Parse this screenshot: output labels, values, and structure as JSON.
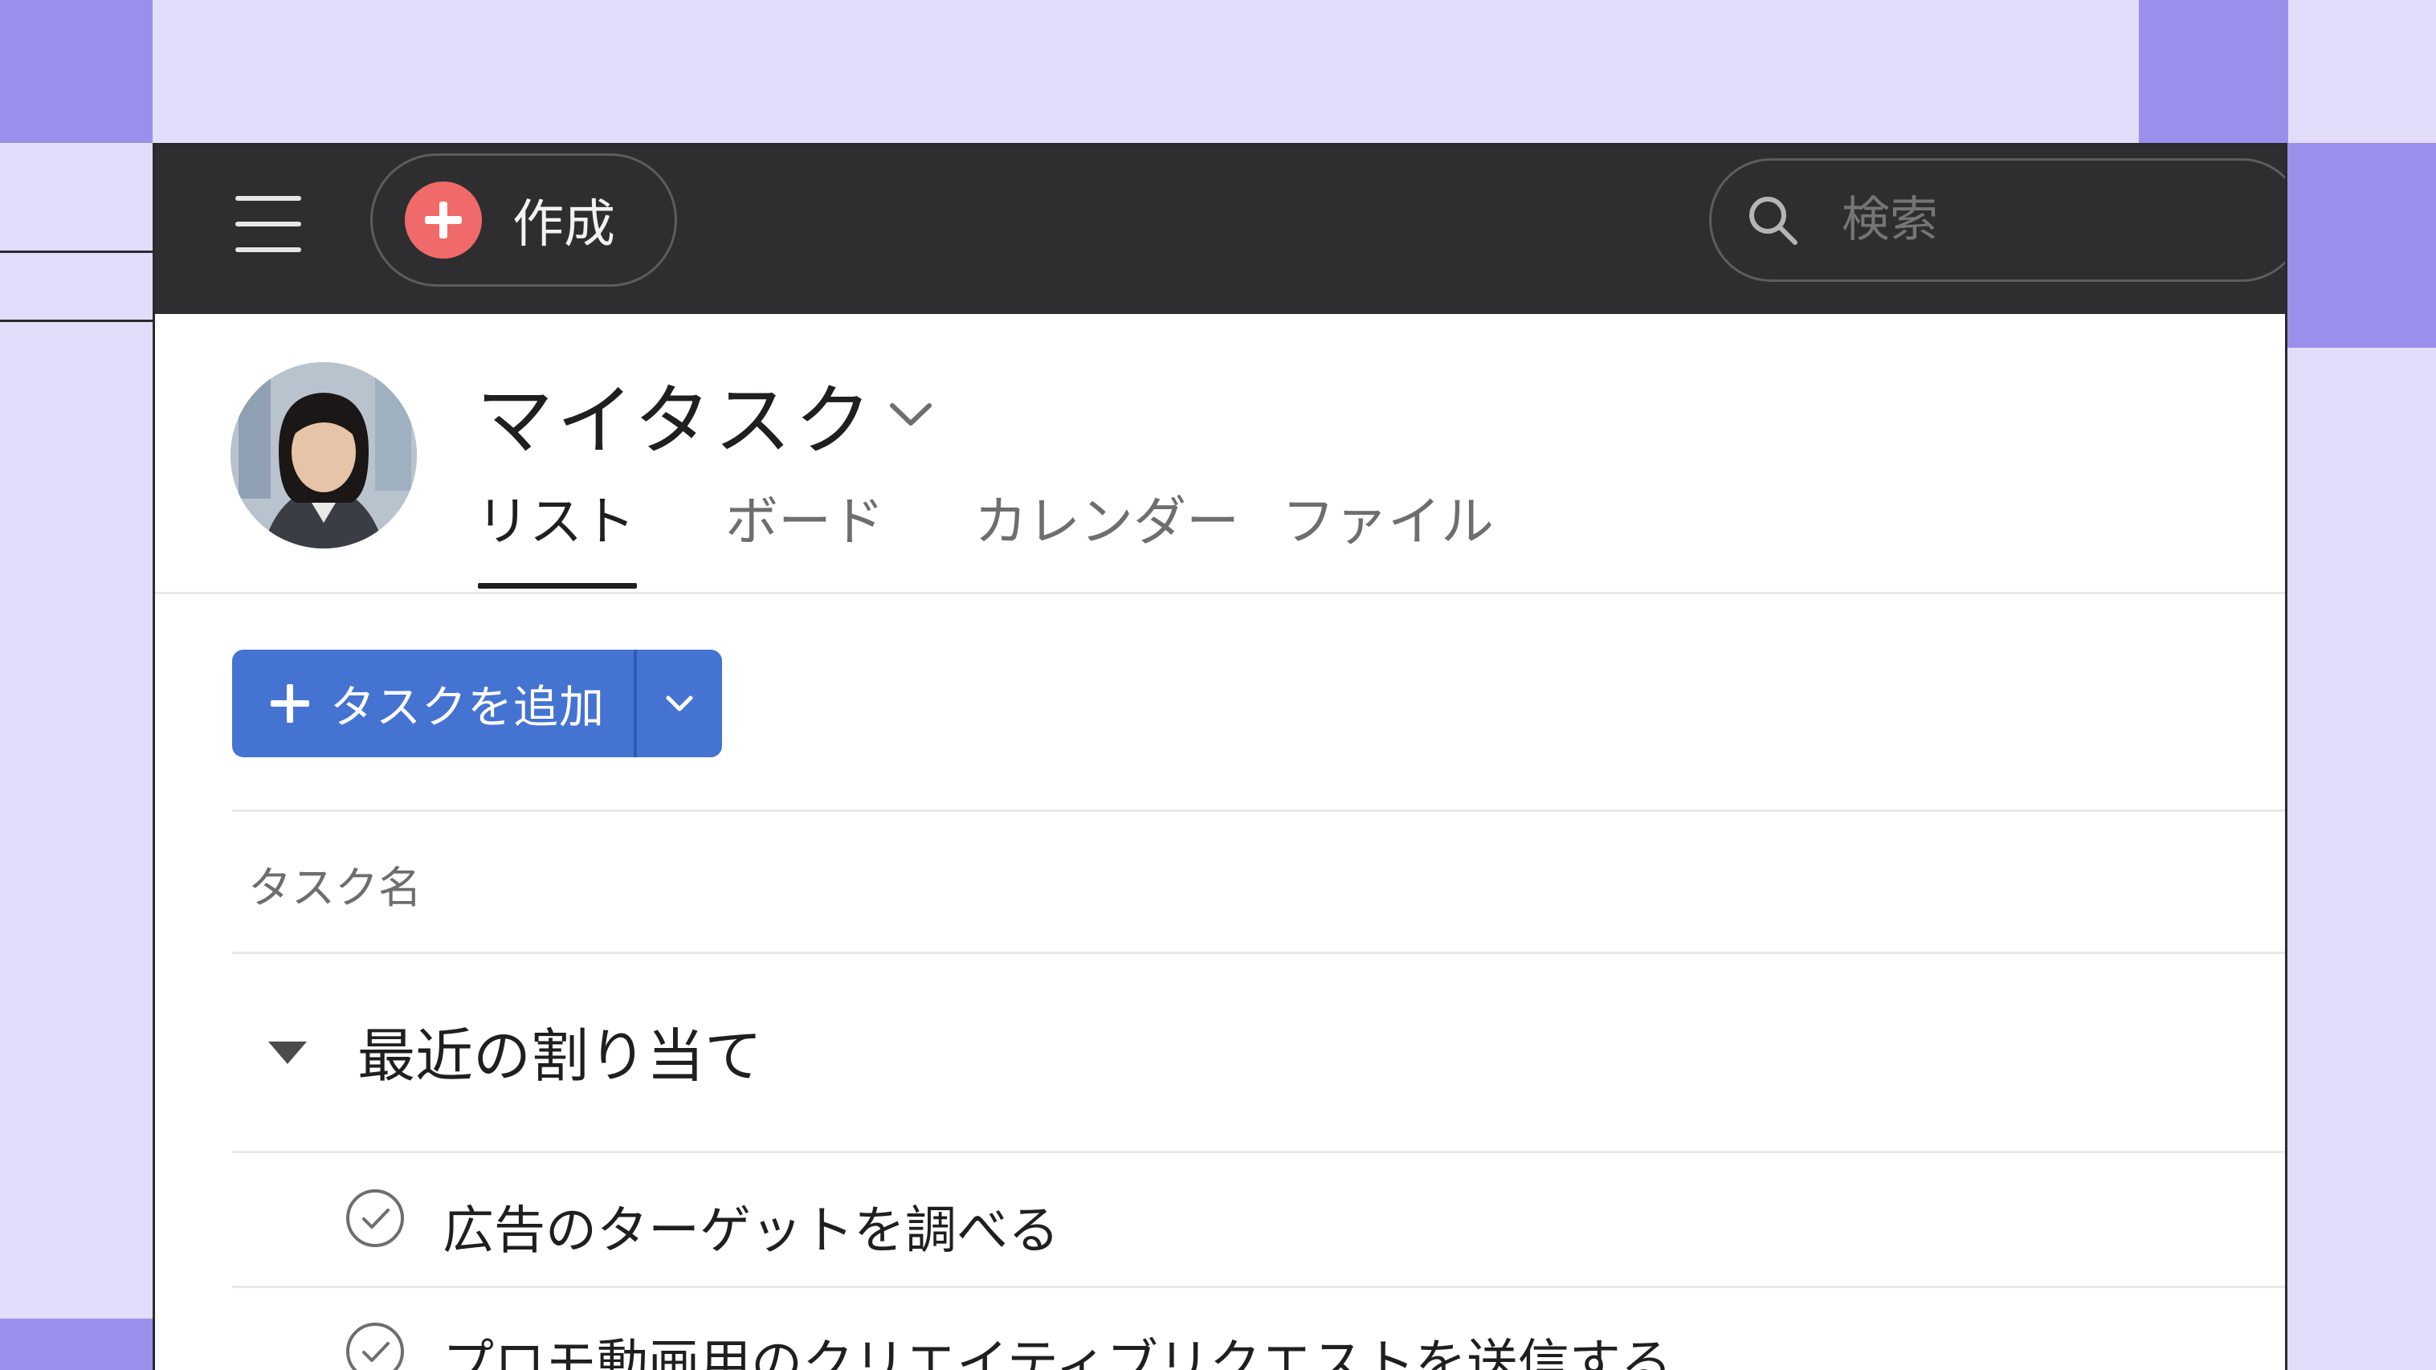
{
  "colors": {
    "background": "#e1ddfa",
    "decoration": "#9a90eb",
    "topbar": "#2e2e30",
    "create_accent": "#f06a6a",
    "primary_button": "#4573d2"
  },
  "topbar": {
    "menu_icon": "hamburger-menu-icon",
    "create_label": "作成",
    "create_icon": "plus-circle-icon",
    "search_icon": "search-icon",
    "search_placeholder": "検索"
  },
  "header": {
    "avatar": "user-avatar",
    "title": "マイタスク",
    "title_icon": "chevron-down-icon",
    "tabs": [
      {
        "label": "リスト",
        "active": true
      },
      {
        "label": "ボード",
        "active": false
      },
      {
        "label": "カレンダー",
        "active": false
      },
      {
        "label": "ファイル",
        "active": false
      }
    ]
  },
  "actions": {
    "add_task_label": "タスクを追加",
    "add_task_icon": "plus-icon",
    "dropdown_icon": "chevron-down-icon"
  },
  "list": {
    "column_header": "タスク名",
    "sections": [
      {
        "title": "最近の割り当て",
        "toggle_icon": "triangle-down-icon",
        "tasks": [
          {
            "name": "広告のターゲットを調べる",
            "icon": "check-circle-icon"
          },
          {
            "name": "プロモ動画用のクリエイティブリクエストを送信する",
            "icon": "check-circle-icon"
          }
        ]
      }
    ]
  }
}
